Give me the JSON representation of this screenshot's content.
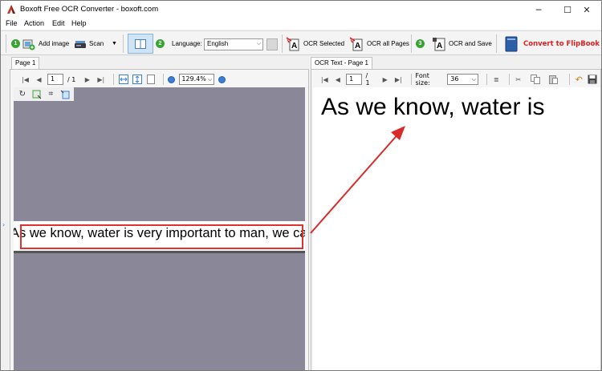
{
  "window": {
    "title": "Boxoft Free OCR Converter - boxoft.com",
    "controls": {
      "minimize": "─",
      "maximize": "☐",
      "close": "✕"
    }
  },
  "menu": {
    "items": [
      "File",
      "Action",
      "Edit",
      "Help"
    ]
  },
  "toolbar": {
    "step1": "1",
    "add_image": "Add image",
    "scan": "Scan",
    "step2": "2",
    "language_label": "Language:",
    "language_value": "English",
    "ocr_selected": "OCR Selected",
    "ocr_all_pages": "OCR all Pages",
    "step3": "3",
    "ocr_and_save": "OCR and Save",
    "convert_flipbook": "Convert to FlipBook"
  },
  "left_pane": {
    "tab": "Page 1",
    "page_value": "1",
    "page_total": "/ 1",
    "zoom": "129.4%",
    "image_text": "As we know, water is very important to man, we can'"
  },
  "right_pane": {
    "tab": "OCR Text - Page 1",
    "page_value": "1",
    "page_total": "/ 1",
    "font_size_label": "Font size:",
    "font_size_value": "36",
    "ocr_text": "As we know, water is"
  },
  "colors": {
    "image_background": "#8a8799",
    "annotation_red": "#e03030",
    "flipbook_red": "#e02020",
    "step_green": "#3aa335"
  }
}
